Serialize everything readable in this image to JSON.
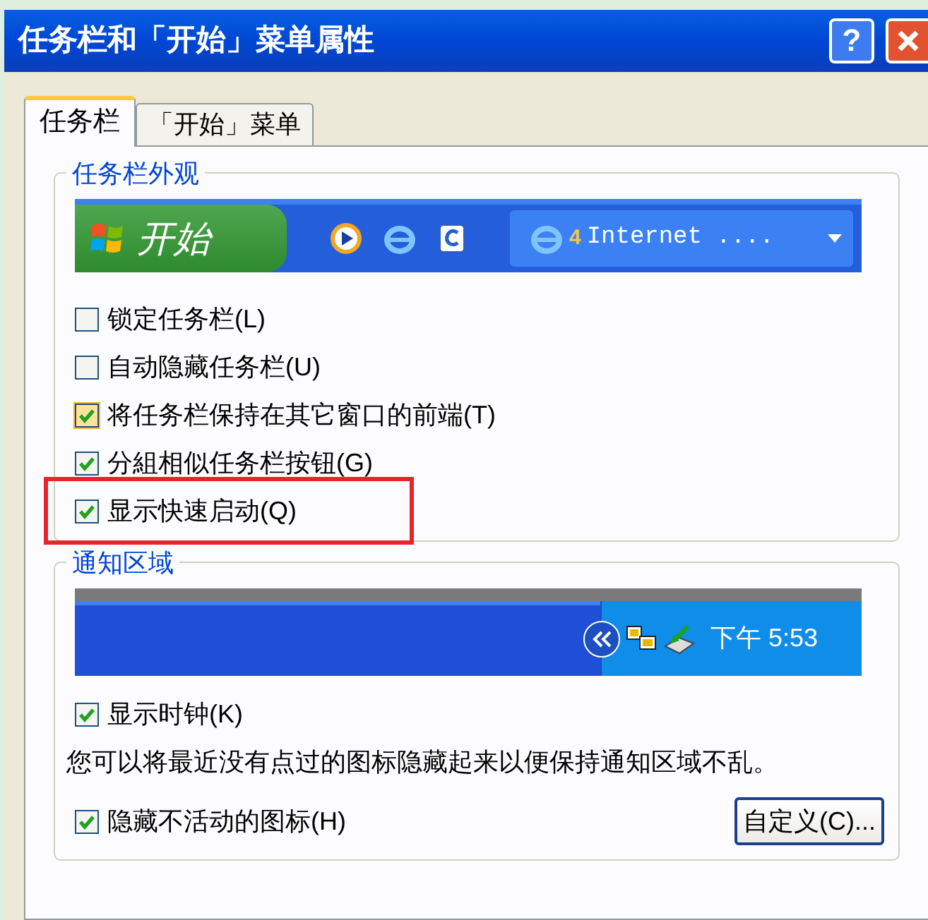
{
  "window": {
    "title": "任务栏和「开始」菜单属性",
    "buttons": [
      {
        "kind": "help",
        "label": "?"
      },
      {
        "kind": "close"
      }
    ]
  },
  "tabs": [
    {
      "label": "任务栏",
      "selected": true
    },
    {
      "label": "「开始」菜单",
      "selected": false
    }
  ],
  "appearance": {
    "title": "任务栏外观",
    "preview": {
      "start_label": "开始",
      "task_badge": "4",
      "task_label": "Internet ...."
    },
    "options": [
      {
        "label": "锁定任务栏(L)",
        "checked": false,
        "hovered": false,
        "highlighted": false
      },
      {
        "label": "自动隐藏任务栏(U)",
        "checked": false,
        "hovered": false,
        "highlighted": false
      },
      {
        "label": "将任务栏保持在其它窗口的前端(T)",
        "checked": true,
        "hovered": true,
        "highlighted": false
      },
      {
        "label": "分組相似任务栏按钮(G)",
        "checked": true,
        "hovered": false,
        "highlighted": false
      },
      {
        "label": "显示快速启动(Q)",
        "checked": true,
        "hovered": false,
        "highlighted": true
      }
    ]
  },
  "notification": {
    "title": "通知区域",
    "preview": {
      "time": "下午 5:53"
    },
    "show_clock": {
      "label": "显示时钟(K)",
      "checked": true
    },
    "description": "您可以将最近没有点过的图标隐藏起来以便保持通知区域不乱。",
    "hide_inactive": {
      "label": "隐藏不活动的图标(H)",
      "checked": true
    },
    "customize_button": "自定义(C)..."
  }
}
